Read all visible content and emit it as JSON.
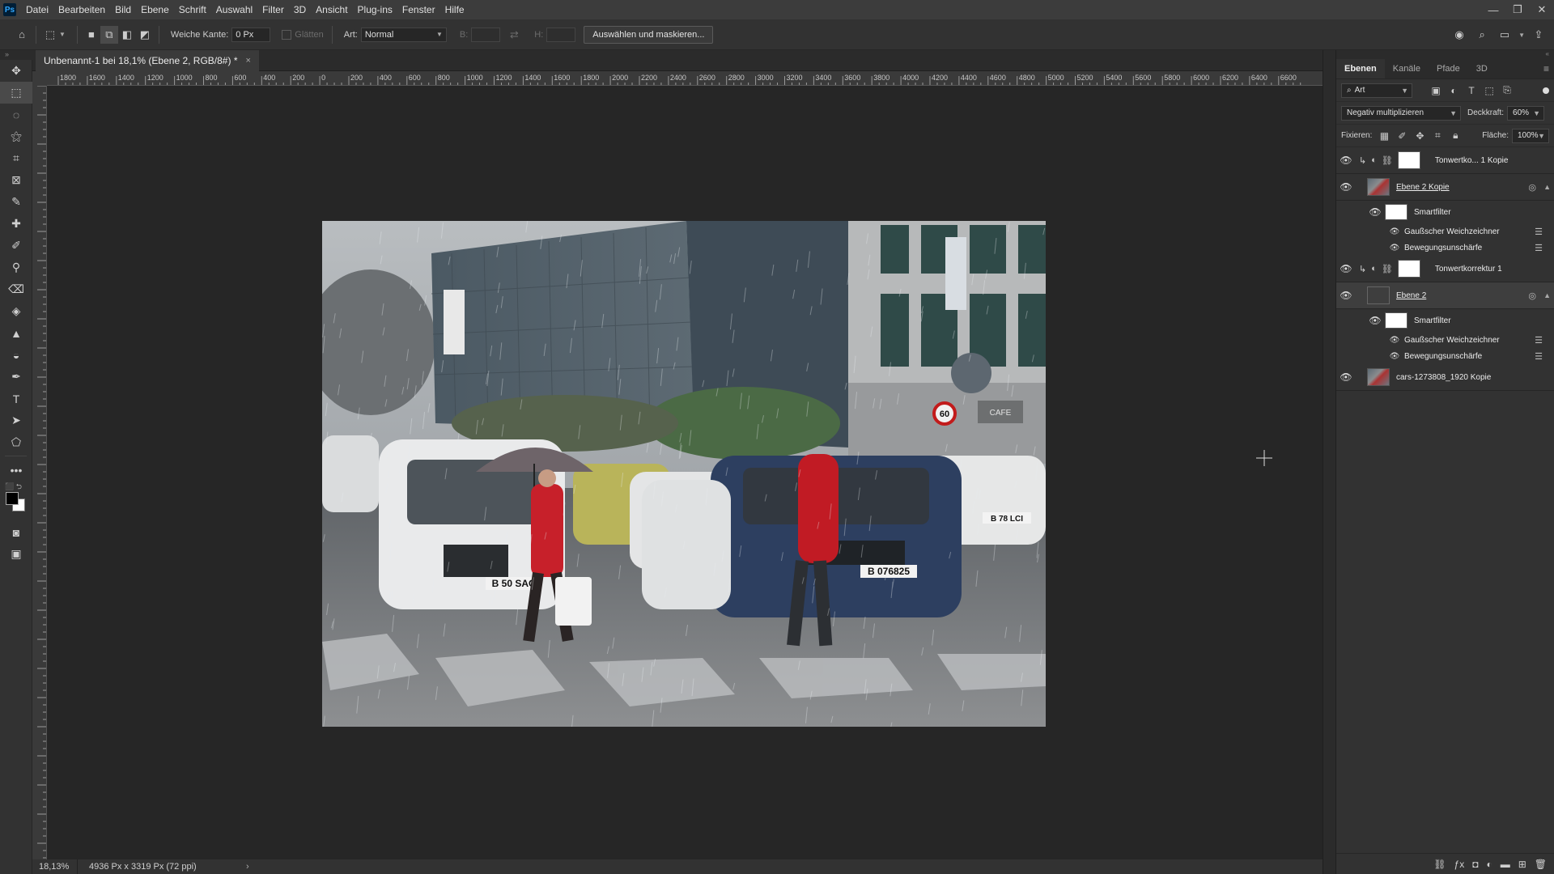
{
  "menubar": {
    "logo": "Ps",
    "items": [
      "Datei",
      "Bearbeiten",
      "Bild",
      "Ebene",
      "Schrift",
      "Auswahl",
      "Filter",
      "3D",
      "Ansicht",
      "Plug-ins",
      "Fenster",
      "Hilfe"
    ]
  },
  "options": {
    "feather_label": "Weiche Kante:",
    "feather_value": "0 Px",
    "antialias_label": "Glätten",
    "style_label": "Art:",
    "style_value": "Normal",
    "width_label": "B:",
    "height_label": "H:",
    "mask_button": "Auswählen und maskieren..."
  },
  "document": {
    "tab_title": "Unbenannt-1 bei 18,1% (Ebene 2, RGB/8#) *",
    "tab_close": "×"
  },
  "ruler_h_labels": [
    "1800",
    "1600",
    "1400",
    "1200",
    "1000",
    "800",
    "600",
    "400",
    "200",
    "0",
    "200",
    "400",
    "600",
    "800",
    "1000",
    "1200",
    "1400",
    "1600",
    "1800",
    "2000",
    "2200",
    "2400",
    "2600",
    "2800",
    "3000",
    "3200",
    "3400",
    "3600",
    "3800",
    "4000",
    "4200",
    "4400",
    "4600",
    "4800",
    "5000",
    "5200",
    "5400",
    "5600",
    "5800",
    "6000",
    "6200",
    "6400",
    "6600"
  ],
  "image_text": {
    "plate_left": "B 50 SAG",
    "plate_right": "B 076825",
    "plate_far": "B 78 LCI",
    "speed_sign": "60",
    "cafe_sign": "CAFE"
  },
  "status": {
    "zoom": "18,13%",
    "doc_info": "4936 Px x 3319 Px (72 ppi)",
    "arrow": "›"
  },
  "panel": {
    "tabs": [
      "Ebenen",
      "Kanäle",
      "Pfade",
      "3D"
    ],
    "filter_kind": "Art",
    "blend_mode": "Negativ multiplizieren",
    "opacity_label": "Deckkraft:",
    "opacity_value": "60%",
    "lock_label": "Fixieren:",
    "fill_label": "Fläche:",
    "fill_value": "100%",
    "layers": [
      {
        "name": "Tonwertko... 1 Kopie"
      },
      {
        "name": "Ebene 2 Kopie"
      },
      {
        "name": "Smartfilter"
      },
      {
        "name": "Gaußscher Weichzeichner"
      },
      {
        "name": "Bewegungsunschärfe"
      },
      {
        "name": "Tonwertkorrektur 1"
      },
      {
        "name": "Ebene 2"
      },
      {
        "name": "Smartfilter"
      },
      {
        "name": "Gaußscher Weichzeichner"
      },
      {
        "name": "Bewegungsunschärfe"
      },
      {
        "name": "cars-1273808_1920 Kopie"
      }
    ]
  }
}
